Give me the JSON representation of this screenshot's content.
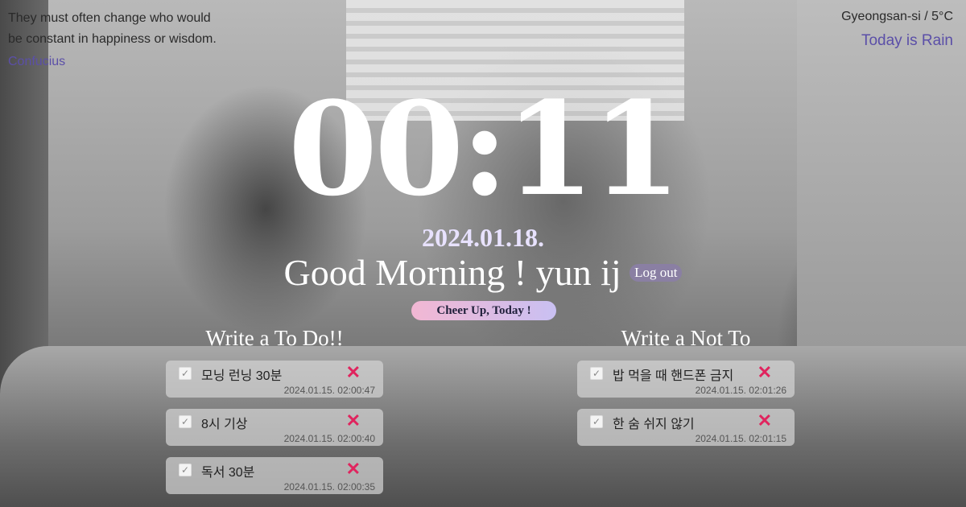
{
  "quote": {
    "text": "They must often change who would be constant in happiness or wisdom.",
    "author": "Confucius"
  },
  "weather": {
    "location": "Gyeongsan-si / 5°C",
    "description": "Today is Rain"
  },
  "clock": {
    "time": "00:11"
  },
  "date": "2024.01.18.",
  "greeting": "Good Morning ! yun ij",
  "logout_label": "Log out",
  "cheer_label": "Cheer Up, Today !",
  "todo": {
    "title": "Write a To Do!!",
    "items": [
      {
        "text": "모닝 런닝 30분",
        "time": "2024.01.15. 02:00:47"
      },
      {
        "text": "8시 기상",
        "time": "2024.01.15. 02:00:40"
      },
      {
        "text": "독서 30분",
        "time": "2024.01.15. 02:00:35"
      }
    ]
  },
  "notto": {
    "title": "Write a Not To",
    "items": [
      {
        "text": "밥 먹을 때 핸드폰 금지",
        "time": "2024.01.15. 02:01:26"
      },
      {
        "text": "한 숨 쉬지 않기",
        "time": "2024.01.15. 02:01:15"
      }
    ]
  },
  "icons": {
    "check": "check-icon",
    "delete": "close-icon"
  },
  "glyphs": {
    "check": "✓",
    "delete": "✕"
  }
}
